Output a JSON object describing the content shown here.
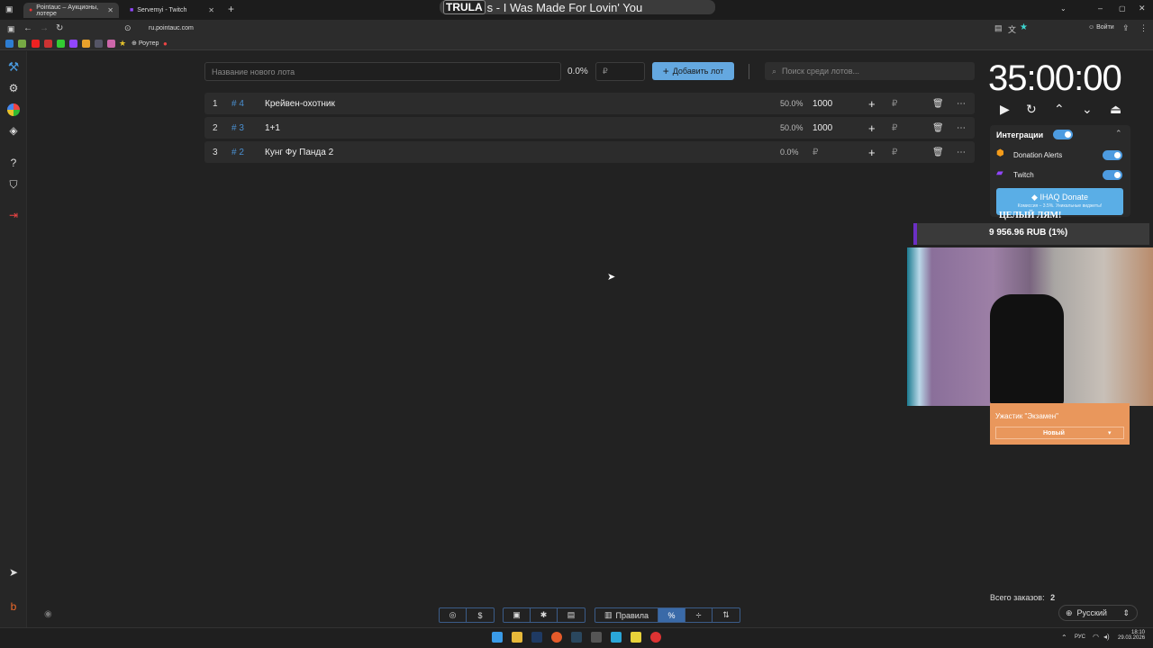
{
  "browser": {
    "tabs": [
      {
        "title": "Pointauc – Аукционы, лотере"
      },
      {
        "title": "Servemyi - Twitch"
      }
    ],
    "url": "ru.pointauc.com",
    "bookmark_folder": "Роутер",
    "signin_label": "Войти"
  },
  "music_overlay": {
    "brand": "TRULA",
    "text": "s - I Was Made For Lovin' You"
  },
  "top_controls": {
    "new_lot_placeholder": "Название нового лота",
    "percent": "0.0%",
    "currency": "₽",
    "add_lot_label": "Добавить лот",
    "search_placeholder": "Поиск среди лотов..."
  },
  "lots": [
    {
      "rank": "1",
      "id": "# 4",
      "name": "Крейвен-охотник",
      "percent": "50.0%",
      "amount": "1000"
    },
    {
      "rank": "2",
      "id": "# 3",
      "name": "1+1",
      "percent": "50.0%",
      "amount": "1000"
    },
    {
      "rank": "3",
      "id": "# 2",
      "name": "Кунг Фу Панда 2",
      "percent": "0.0%",
      "amount": "₽"
    }
  ],
  "timer": "35:00:00",
  "integrations": {
    "title": "Интеграции",
    "items": [
      {
        "label": "Donation Alerts"
      },
      {
        "label": "Twitch"
      }
    ],
    "ihaq_label": "IHAQ Donate",
    "ihaq_sub": "Комиссия – 3.5%. Уникальные виджеты!"
  },
  "donation_overlay": {
    "title": "ЦЕЛЫЙ ЛЯМ!",
    "amount": "9 956.96 RUB (1%)"
  },
  "notification": {
    "text": "Ужастик \"Экзамен\"",
    "select": "Новый"
  },
  "footer": {
    "orders_label": "Всего заказов:",
    "orders_count": "2",
    "language": "Русский"
  },
  "toolbar": {
    "rules_label": "Правила"
  },
  "taskbar": {
    "lang": "РУС",
    "time": "18:10",
    "date": "29.03.2026"
  },
  "colors": {
    "accent": "#64a8e0",
    "toggle": "#4d9be0",
    "notification": "#e9975c",
    "donation_bar": "#6b2fc4"
  }
}
